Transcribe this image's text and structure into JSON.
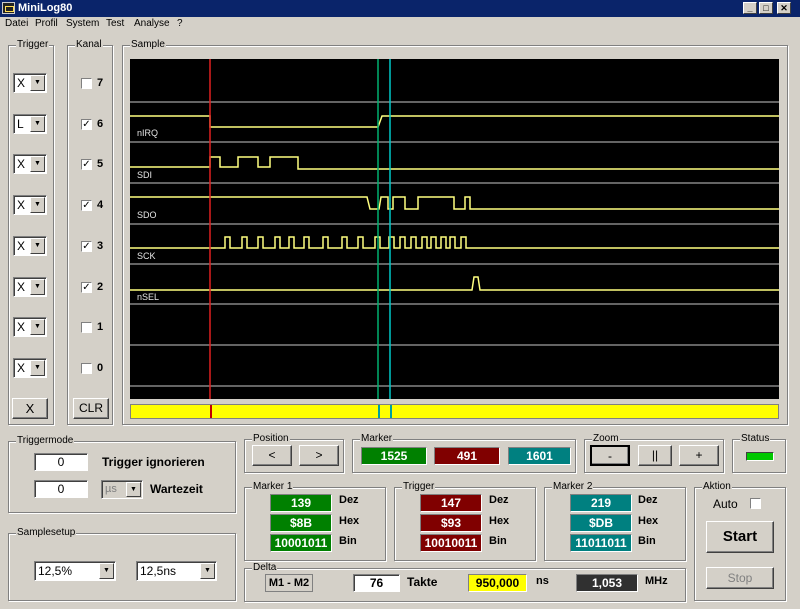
{
  "window": {
    "title": "MiniLog80",
    "minimize": "_",
    "maximize": "□",
    "close": "✕"
  },
  "menu": [
    "Datei",
    "Profil",
    "System",
    "Test",
    "Analyse",
    "?"
  ],
  "trigger_panel": {
    "label": "Trigger",
    "values": [
      "X",
      "L",
      "X",
      "X",
      "X",
      "X",
      "X",
      "X"
    ],
    "clear_label": "X"
  },
  "kanal_panel": {
    "label": "Kanal",
    "channels": [
      {
        "num": "7",
        "checked": false
      },
      {
        "num": "6",
        "checked": true
      },
      {
        "num": "5",
        "checked": true
      },
      {
        "num": "4",
        "checked": true
      },
      {
        "num": "3",
        "checked": true
      },
      {
        "num": "2",
        "checked": true
      },
      {
        "num": "1",
        "checked": false
      },
      {
        "num": "0",
        "checked": false
      }
    ],
    "clr_label": "CLR"
  },
  "sample": {
    "label": "Sample",
    "signals": [
      "nIRQ",
      "SDI",
      "SDO",
      "SCK",
      "nSEL"
    ]
  },
  "triggermode": {
    "label": "Triggermode",
    "ignore_value": "0",
    "ignore_label": "Trigger ignorieren",
    "wait_value": "0",
    "wait_unit": "µs",
    "wait_label": "Wartezeit"
  },
  "samplesetup": {
    "label": "Samplesetup",
    "rate": "12,5%",
    "period": "12,5ns"
  },
  "position": {
    "label": "Position",
    "left": "<",
    "right": ">"
  },
  "marker": {
    "label": "Marker",
    "m1": "1525",
    "trigger": "491",
    "m2": "1601"
  },
  "zoom": {
    "label": "Zoom",
    "minus": "-",
    "pause": "||",
    "plus": "+"
  },
  "status": {
    "label": "Status"
  },
  "marker1": {
    "label": "Marker 1",
    "dez": "139",
    "hex": "$8B",
    "bin": "10001011"
  },
  "trigger_vals": {
    "label": "Trigger",
    "dez": "147",
    "hex": "$93",
    "bin": "10010011"
  },
  "marker2": {
    "label": "Marker 2",
    "dez": "219",
    "hex": "$DB",
    "bin": "11011011"
  },
  "units": {
    "dez": "Dez",
    "hex": "Hex",
    "bin": "Bin"
  },
  "delta": {
    "label": "Delta",
    "mode": "M1 - M2",
    "takte": "76",
    "takte_label": "Takte",
    "ns_value": "950,000",
    "ns_label": "ns",
    "mhz_value": "1,053",
    "mhz_label": "MHz"
  },
  "aktion": {
    "label": "Aktion",
    "auto_label": "Auto",
    "auto_checked": false,
    "start": "Start",
    "stop": "Stop"
  },
  "colors": {
    "m1": "#008000",
    "trigger": "#800000",
    "m2": "#008080",
    "signal": "#ffff80",
    "ns_bg": "#ffff00",
    "mhz_bg": "#303030",
    "status_led": "#00c800"
  }
}
